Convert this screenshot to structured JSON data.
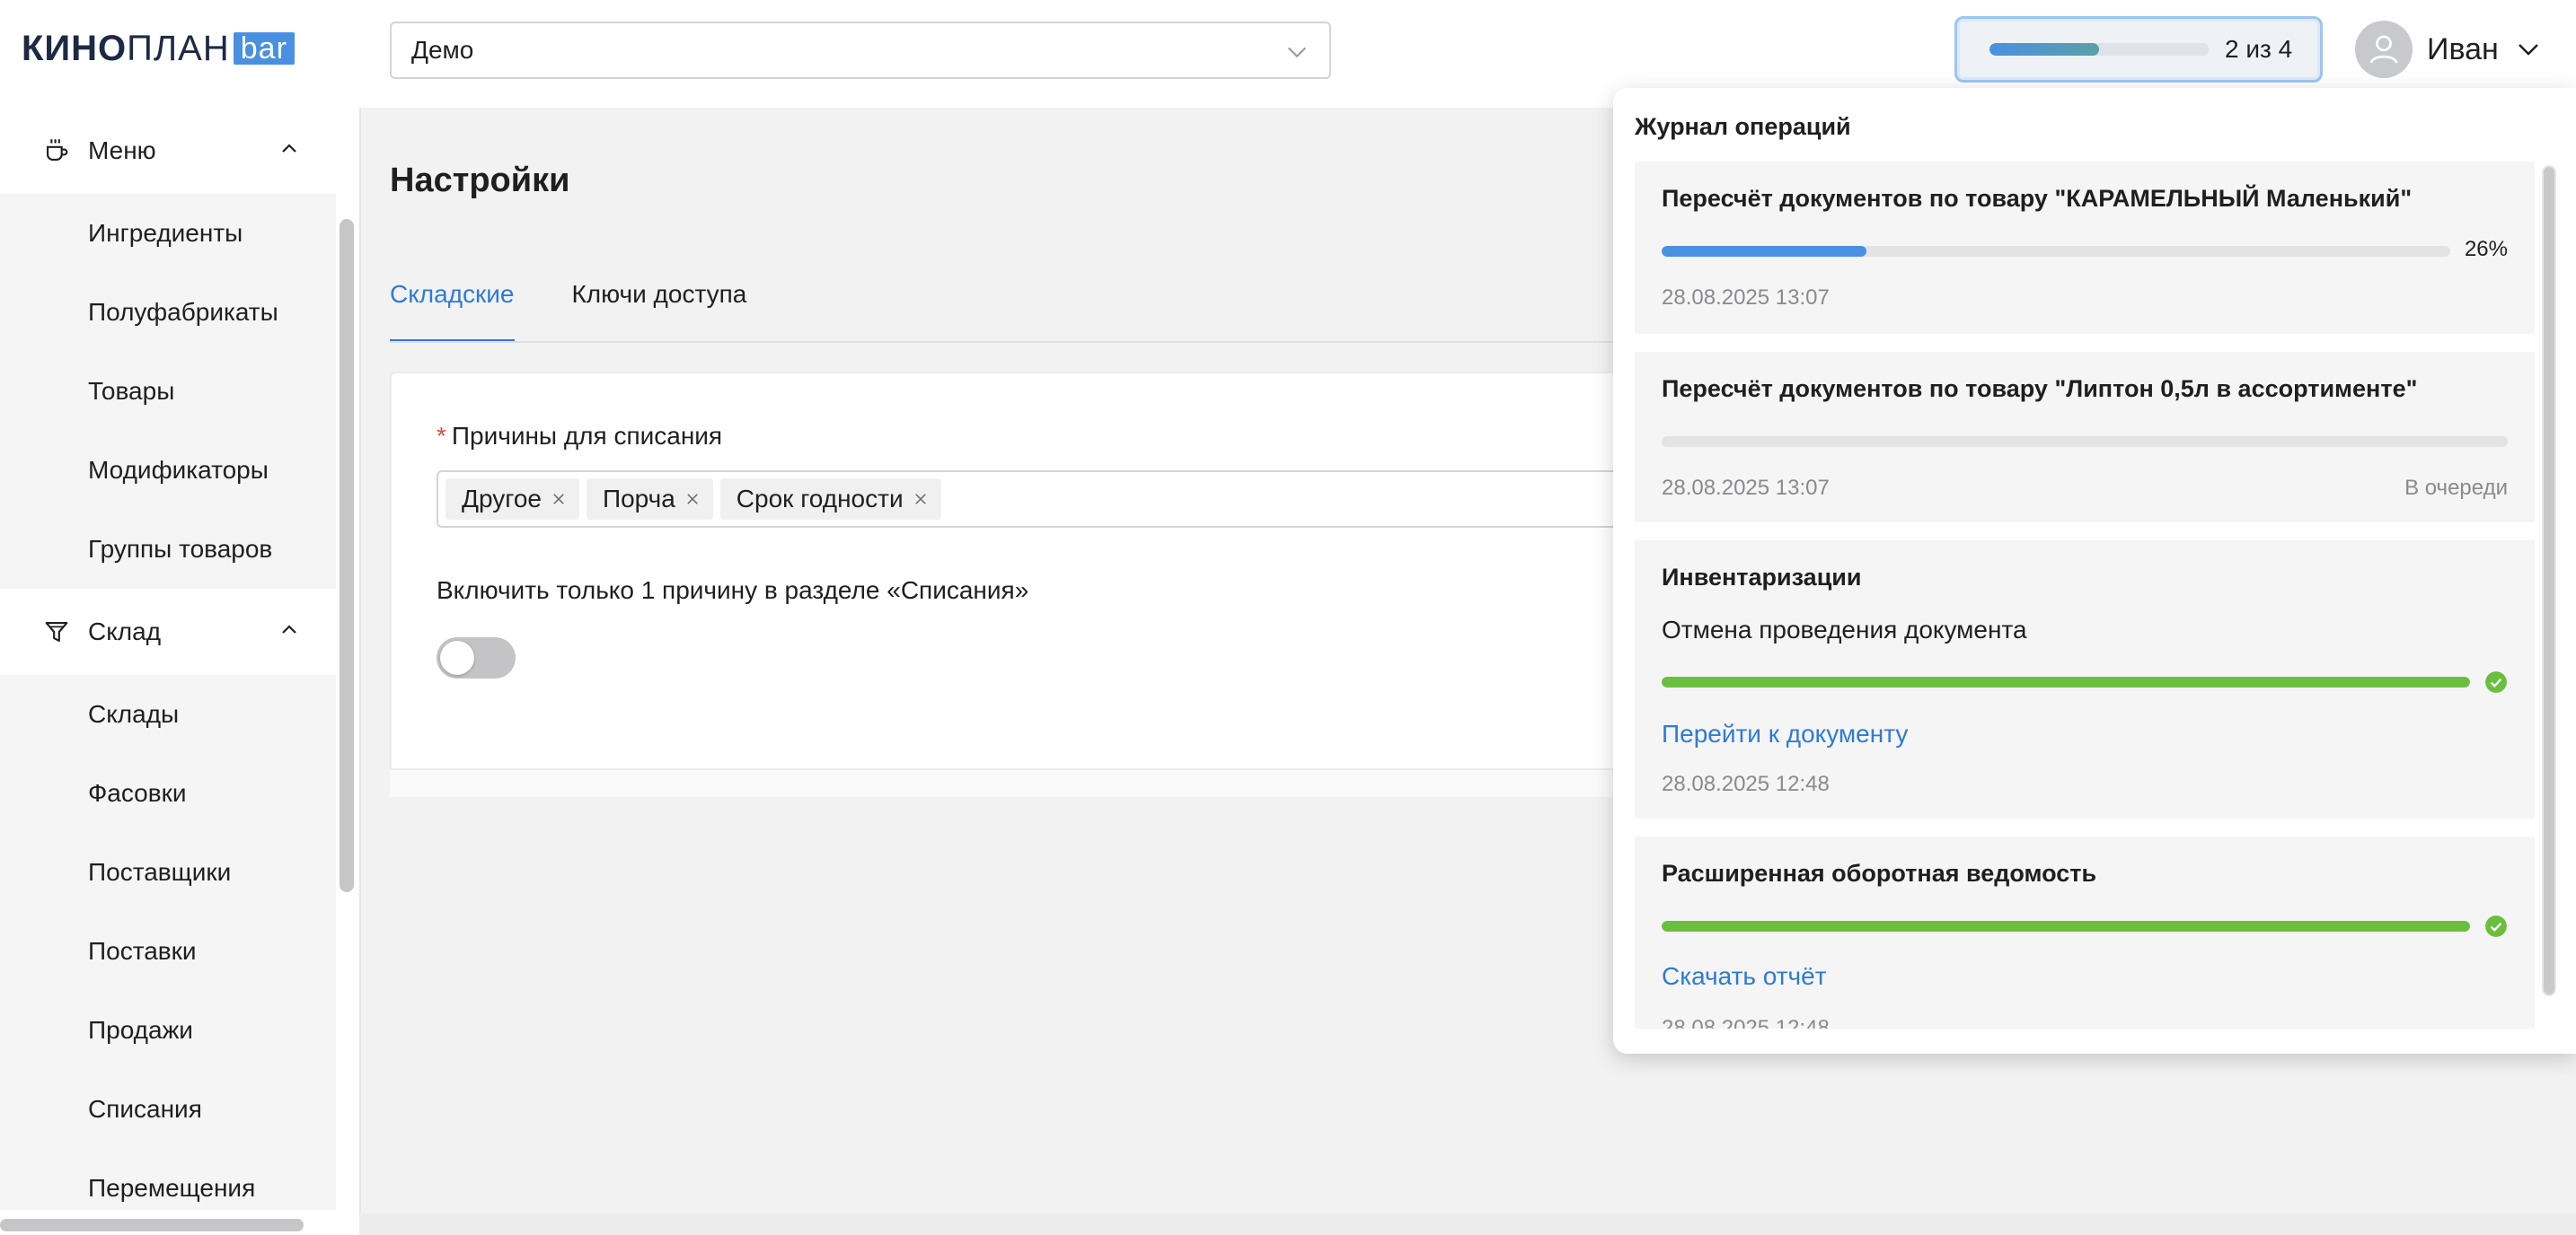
{
  "header": {
    "logo_part1": "КИНО",
    "logo_part2": "ПЛАН",
    "logo_badge": "bar",
    "org_select_value": "Демо",
    "operations_progress": 0.5,
    "operations_counter": "2 из 4",
    "user_name": "Иван"
  },
  "sidebar": {
    "groups": [
      {
        "label": "Меню",
        "icon": "coffee-cup-icon",
        "expanded": true,
        "items": [
          "Ингредиенты",
          "Полуфабрикаты",
          "Товары",
          "Модификаторы",
          "Группы товаров"
        ]
      },
      {
        "label": "Склад",
        "icon": "warehouse-filter-icon",
        "expanded": true,
        "items": [
          "Склады",
          "Фасовки",
          "Поставщики",
          "Поставки",
          "Продажи",
          "Списания",
          "Перемещения"
        ]
      }
    ]
  },
  "main": {
    "title": "Настройки",
    "tabs": [
      {
        "label": "Складские",
        "active": true
      },
      {
        "label": "Ключи доступа",
        "active": false
      }
    ],
    "writeoff_reasons_label": "Причины для списания",
    "required_mark": "*",
    "writeoff_reasons": [
      "Другое",
      "Порча",
      "Срок годности"
    ],
    "single_reason_toggle_label": "Включить только 1 причину в разделе «Списания»",
    "single_reason_toggle_on": false
  },
  "journal": {
    "title": "Журнал операций",
    "operations": [
      {
        "title": "Пересчёт документов по товару \"КАРАМЕЛЬНЫЙ Маленький\"",
        "progress": 0.26,
        "progress_label": "26%",
        "date": "28.08.2025 13:07",
        "color": "#4a90e2"
      },
      {
        "title": "Пересчёт документов по товару \"Липтон 0,5л в ассортименте\"",
        "progress": 0,
        "date": "28.08.2025 13:07",
        "status": "В очереди"
      },
      {
        "title": "Инвентаризации",
        "subtitle": "Отмена проведения документа",
        "progress": 1,
        "link": "Перейти к документу",
        "date": "28.08.2025 12:48",
        "color": "#6bbf3f"
      },
      {
        "title": "Расширенная оборотная ведомость",
        "progress": 1,
        "link": "Скачать отчёт",
        "date": "28.08.2025 12:48",
        "color": "#6bbf3f"
      }
    ]
  },
  "colors": {
    "accent": "#2f7ad6",
    "success": "#6bbf3f",
    "required": "#e5483f"
  }
}
